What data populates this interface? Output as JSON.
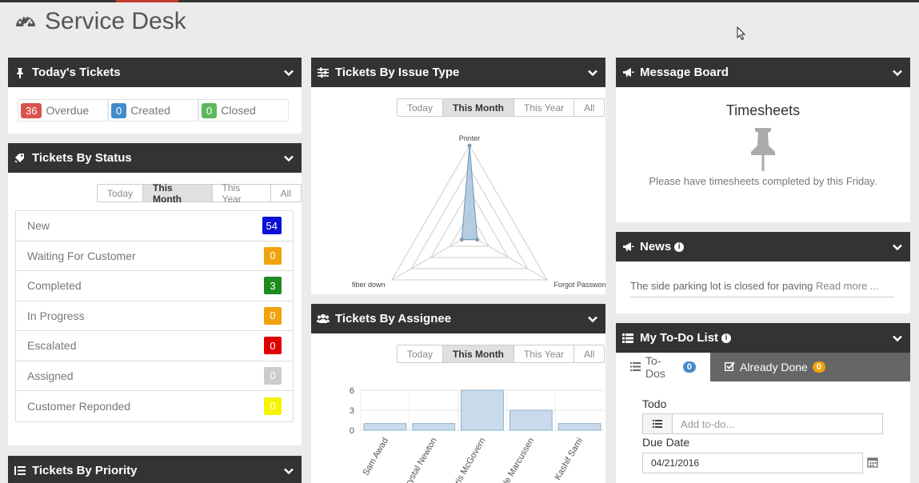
{
  "app": {
    "title": "Service Desk",
    "icon": "dashboard-gauge-icon"
  },
  "colors": {
    "red": "#d9534f",
    "blue": "#428bca",
    "green": "#5cb85c",
    "navy": "#0a0fd4",
    "orange": "#f0a30a",
    "darkgreen": "#1e8c1e",
    "bright_red": "#e00000",
    "grey": "#cccccc",
    "yellow": "#f5f500"
  },
  "range_tabs": [
    "Today",
    "This Month",
    "This Year",
    "All"
  ],
  "todays_tickets": {
    "title": "Today's Tickets",
    "icon": "pushpin-icon",
    "items": [
      {
        "count": "36",
        "label": "Overdue"
      },
      {
        "count": "0",
        "label": "Created"
      },
      {
        "count": "0",
        "label": "Closed"
      }
    ]
  },
  "by_status": {
    "title": "Tickets By Status",
    "icon": "tags-icon",
    "rows": [
      {
        "label": "New",
        "value": "54"
      },
      {
        "label": "Waiting For Customer",
        "value": "0"
      },
      {
        "label": "Completed",
        "value": "3"
      },
      {
        "label": "In Progress",
        "value": "0"
      },
      {
        "label": "Escalated",
        "value": "0"
      },
      {
        "label": "Assigned",
        "value": "0"
      },
      {
        "label": "Customer Reponded",
        "value": "0"
      }
    ]
  },
  "by_priority": {
    "title": "Tickets By Priority",
    "icon": "list-ol-icon"
  },
  "by_issue_type": {
    "title": "Tickets By Issue Type",
    "icon": "sliders-icon"
  },
  "by_assignee": {
    "title": "Tickets By Assignee",
    "icon": "users-icon"
  },
  "message_board": {
    "title": "Message Board",
    "icon": "bullhorn-icon",
    "heading": "Timesheets",
    "pin_icon": "thumbtack-icon",
    "text": "Please have timesheets completed by this Friday."
  },
  "news": {
    "title": "News",
    "icon": "bullhorn-icon",
    "text": "The side parking lot is closed for paving",
    "more": "Read more ..."
  },
  "todo": {
    "title": "My To-Do List",
    "icon": "list-icon",
    "tab_todos": "To-Dos",
    "tab_todos_count": "0",
    "tab_done": "Already Done",
    "tab_done_count": "0",
    "todo_label": "Todo",
    "todo_placeholder": "Add to-do...",
    "due_label": "Due Date",
    "due_value": "04/21/2016"
  },
  "chart_data": [
    {
      "type": "radar",
      "axes": [
        "Printer",
        "Forgot Password",
        "fiber down"
      ],
      "values": [
        1,
        0.1,
        0.1
      ]
    },
    {
      "type": "bar",
      "categories": [
        "Sam Awad",
        "Crystal Newton",
        "Chris McGovern",
        "Kyle Marcussen",
        "Kashif Sami"
      ],
      "values": [
        1,
        1,
        6,
        3,
        1
      ],
      "yticks": [
        0,
        3,
        6
      ],
      "ylim": [
        0,
        6
      ]
    }
  ]
}
